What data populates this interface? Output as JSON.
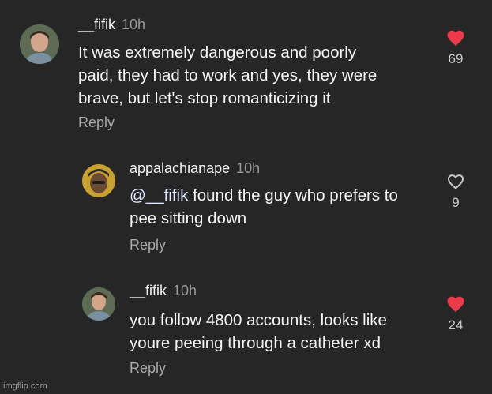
{
  "comments": [
    {
      "username": "__fifik",
      "time": "10h",
      "text": "It was extremely dangerous and poorly\npaid, they had to work and yes, they were\nbrave, but let's stop romanticizing it",
      "reply_label": "Reply",
      "likes": "69",
      "liked": true
    },
    {
      "username": "appalachianape",
      "time": "10h",
      "mention": "@__fifik",
      "text": " found the guy who prefers to\npee sitting down",
      "reply_label": "Reply",
      "likes": "9",
      "liked": false
    },
    {
      "username": "__fifik",
      "time": "10h",
      "text": "you follow 4800 accounts, looks like\nyoure peeing through a catheter xd",
      "reply_label": "Reply",
      "likes": "24",
      "liked": true
    }
  ],
  "colors": {
    "background": "#262626",
    "heart_liked": "#ed3a4a",
    "heart_outline": "#c8c8c8",
    "secondary_text": "#a8a8a8"
  },
  "watermark": "imgflip.com"
}
